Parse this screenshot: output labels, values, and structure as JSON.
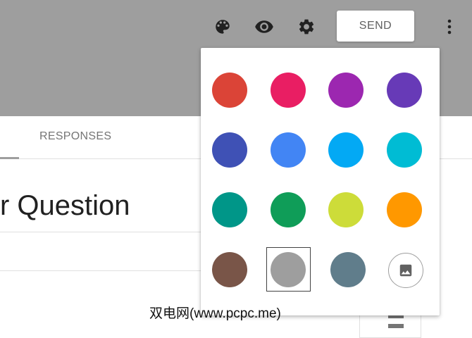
{
  "toolbar": {
    "palette_icon": "palette-icon",
    "preview_icon": "eye-icon",
    "settings_icon": "gear-icon",
    "send_label": "SEND",
    "more_icon": "more-vert-icon"
  },
  "tabs": {
    "responses_label": "RESPONSES"
  },
  "form": {
    "title_fragment": "r Question"
  },
  "theme_picker": {
    "colors": [
      {
        "name": "red",
        "hex": "#db4437"
      },
      {
        "name": "pink",
        "hex": "#e91e63"
      },
      {
        "name": "purple",
        "hex": "#9c27b0"
      },
      {
        "name": "deep-purple",
        "hex": "#673ab7"
      },
      {
        "name": "indigo",
        "hex": "#3f51b5"
      },
      {
        "name": "blue",
        "hex": "#4285f4"
      },
      {
        "name": "light-blue",
        "hex": "#03a9f4"
      },
      {
        "name": "cyan",
        "hex": "#00bcd4"
      },
      {
        "name": "teal",
        "hex": "#009688"
      },
      {
        "name": "green",
        "hex": "#0f9d58"
      },
      {
        "name": "lime",
        "hex": "#cddc39"
      },
      {
        "name": "orange",
        "hex": "#ff9800"
      },
      {
        "name": "brown",
        "hex": "#795548"
      },
      {
        "name": "grey",
        "hex": "#9e9e9e",
        "selected": true
      },
      {
        "name": "blue-grey",
        "hex": "#607d8b"
      }
    ],
    "image_option_icon": "image-icon"
  },
  "watermark": "双电网(www.pcpc.me)"
}
